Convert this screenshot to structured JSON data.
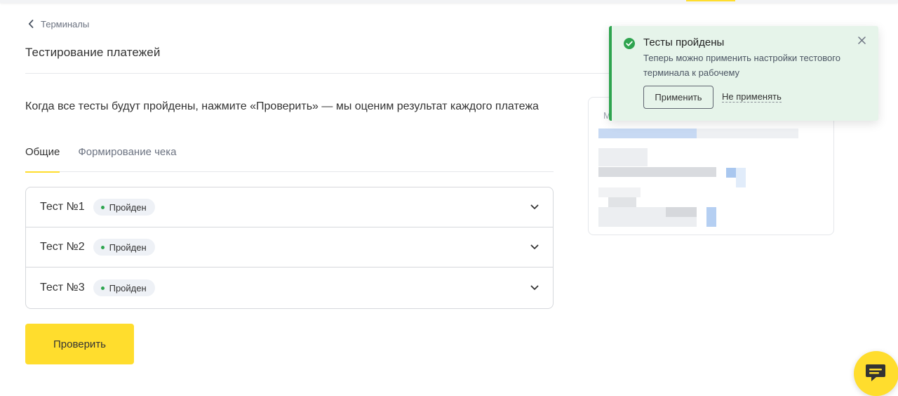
{
  "breadcrumb": {
    "back_label": "Терминалы",
    "icon": "chevron-left-icon"
  },
  "page": {
    "title": "Тестирование платежей",
    "intro": "Когда все тесты будут пройдены, нажмите «Проверить» — мы оценим результат каждого платежа"
  },
  "tabs": [
    {
      "label": "Общие",
      "active": true
    },
    {
      "label": "Формирование чека",
      "active": false
    }
  ],
  "tests": [
    {
      "name": "Тест №1",
      "status": "Пройден"
    },
    {
      "name": "Тест №2",
      "status": "Пройден"
    },
    {
      "name": "Тест №3",
      "status": "Пройден"
    }
  ],
  "actions": {
    "check_label": "Проверить"
  },
  "side_card": {
    "letter": "М"
  },
  "toast": {
    "title": "Тесты пройдены",
    "text": "Теперь можно применить настройки тестового терминала к рабочему",
    "apply_label": "Применить",
    "skip_label": "Не применять",
    "icon": "check-circle-icon"
  },
  "colors": {
    "accent": "#ffdd2d",
    "success": "#2ea44f",
    "toast_bg": "#e6f4ea",
    "badge_bg": "#eef1f6"
  }
}
